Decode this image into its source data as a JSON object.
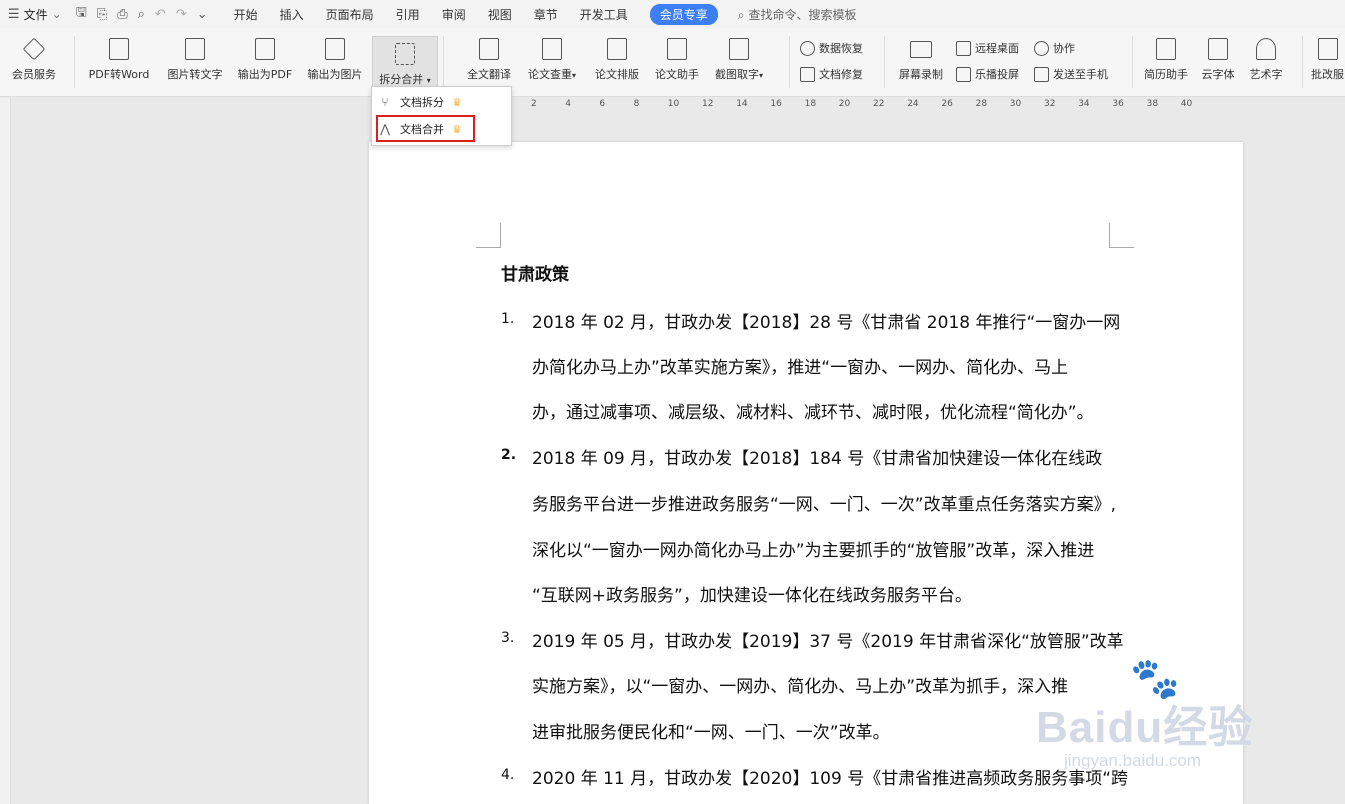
{
  "menubar": {
    "file": "文件",
    "tabs": [
      "开始",
      "插入",
      "页面布局",
      "引用",
      "审阅",
      "视图",
      "章节",
      "开发工具"
    ],
    "vip": "会员专享",
    "search": "查找命令、搜索模板"
  },
  "ribbon": {
    "buttons": [
      {
        "label": "会员服务",
        "icon": "diamond-icon"
      },
      {
        "label": "PDF转Word",
        "icon": "pdf-word-icon"
      },
      {
        "label": "图片转文字",
        "icon": "image-text-icon"
      },
      {
        "label": "输出为PDF",
        "icon": "export-pdf-icon"
      },
      {
        "label": "输出为图片",
        "icon": "export-image-icon"
      },
      {
        "label": "拆分合并",
        "icon": "split-merge-icon"
      },
      {
        "label": "全文翻译",
        "icon": "translate-icon"
      },
      {
        "label": "论文查重",
        "icon": "plagiarism-icon"
      },
      {
        "label": "论文排版",
        "icon": "typeset-icon"
      },
      {
        "label": "论文助手",
        "icon": "thesis-assistant-icon"
      },
      {
        "label": "截图取字",
        "icon": "ocr-capture-icon"
      }
    ],
    "small": {
      "data_recovery": "数据恢复",
      "doc_repair": "文档修复",
      "remote_desktop": "远程桌面",
      "collaborate": "协作",
      "cast": "乐播投屏",
      "send_phone": "发送至手机"
    },
    "right_buttons": [
      {
        "label": "屏幕录制",
        "icon": "screen-record-icon"
      },
      {
        "label": "简历助手",
        "icon": "resume-icon"
      },
      {
        "label": "云字体",
        "icon": "cloud-font-icon"
      },
      {
        "label": "艺术字",
        "icon": "art-text-icon"
      },
      {
        "label": "批改服",
        "icon": "review-icon"
      }
    ]
  },
  "dropdown": {
    "split": "文档拆分",
    "merge": "文档合并"
  },
  "ruler": [
    "2",
    "4",
    "6",
    "8",
    "10",
    "12",
    "14",
    "16",
    "18",
    "20",
    "22",
    "24",
    "26",
    "28",
    "30",
    "32",
    "34",
    "36",
    "38",
    "40"
  ],
  "document": {
    "title": "甘肃政策",
    "items": [
      {
        "num": "1.",
        "lines": [
          "2018 年 02 月，甘政办发【2018】28 号《甘肃省 2018 年推行“一窗办一网",
          "办简化办马上办”改革实施方案》，推进“一窗办、一网办、简化办、马上",
          "办，通过减事项、减层级、减材料、减环节、减时限，优化流程“简化办”。"
        ]
      },
      {
        "num": "2.",
        "lines": [
          "2018 年 09 月，甘政办发【2018】184 号《甘肃省加快建设一体化在线政",
          "务服务平台进一步推进政务服务“一网、一门、一次”改革重点任务落实方案》,",
          "深化以“一窗办一网办简化办马上办”为主要抓手的“放管服”改革，深入推进",
          "“互联网+政务服务”，加快建设一体化在线政务服务平台。"
        ]
      },
      {
        "num": "3.",
        "lines": [
          "2019 年 05 月，甘政办发【2019】37 号《2019 年甘肃省深化“放管服”改革",
          "实施方案》，以“一窗办、一网办、简化办、马上办”改革为抓手，深入推",
          "进审批服务便民化和“一网、一门、一次”改革。"
        ]
      },
      {
        "num": "4.",
        "lines": [
          "2020 年 11 月，甘政办发【2020】109 号《甘肃省推进高频政务服务事项“跨"
        ]
      }
    ]
  },
  "watermark": {
    "text": "Baidu经验",
    "sub": "jingyan.baidu.com"
  }
}
